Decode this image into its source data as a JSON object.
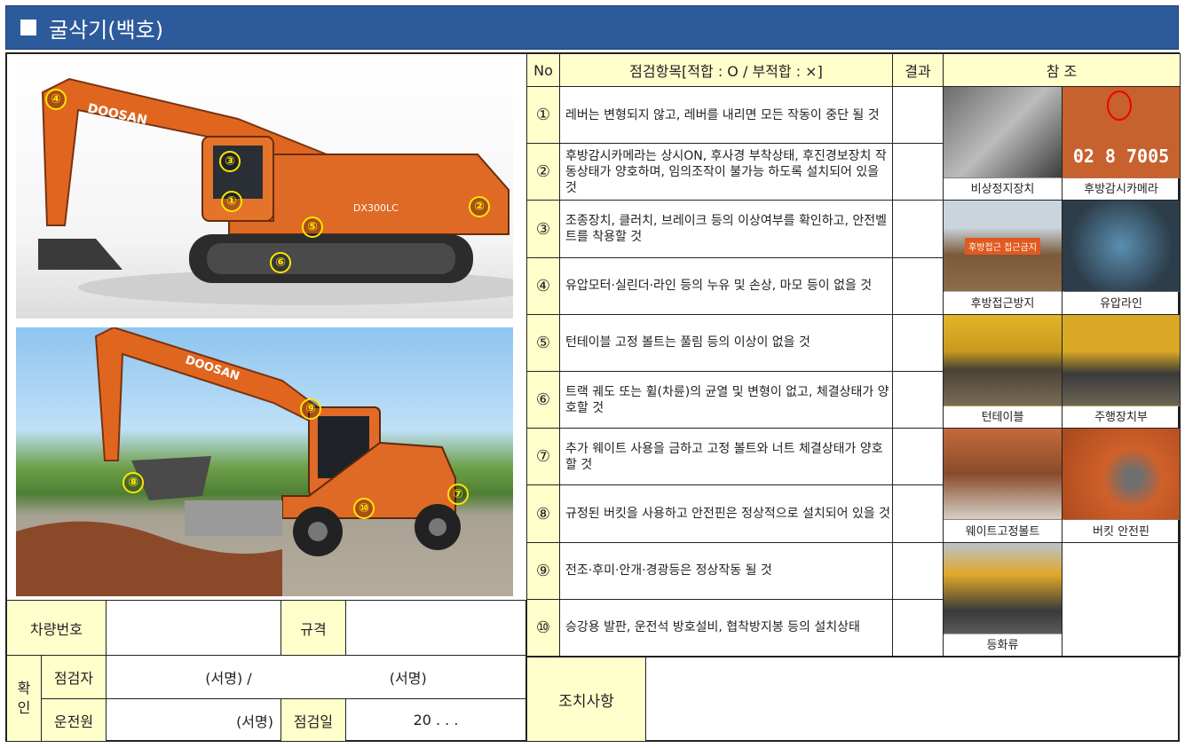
{
  "header": {
    "title": "굴삭기(백호)",
    "color": "#2d5a9b"
  },
  "photos": {
    "top": {
      "brand": "DOOSAN",
      "model": "DX300LC",
      "markers": [
        "④",
        "③",
        "①",
        "②",
        "⑤",
        "⑥"
      ]
    },
    "bottom": {
      "brand": "DOOSAN",
      "markers": [
        "⑨",
        "⑧",
        "⑦",
        "⑩"
      ]
    }
  },
  "info": {
    "vehicle_no_label": "차량번호",
    "spec_label": "규격",
    "confirm_label": "확\n인",
    "inspector_label": "점검자",
    "inspector_sign": "(서명)  /",
    "inspector_sign2": "(서명)",
    "driver_label": "운전원",
    "driver_sign": "(서명)",
    "date_label": "점검일",
    "date_value": "20   .    .    ."
  },
  "checklist": {
    "headers": {
      "no": "No",
      "item": "점검항목[적합 : O / 부적합 : ×]",
      "result": "결과",
      "ref": "참  조"
    },
    "rows": [
      {
        "no": "①",
        "text": "레버는 변형되지 않고, 레버를 내리면 모든 작동이 중단 될 것"
      },
      {
        "no": "②",
        "text": "후방감시카메라는 상시ON, 후사경 부착상태, 후진경보장치 작동상태가 양호하며, 임의조작이 불가능 하도록 설치되어 있을 것"
      },
      {
        "no": "③",
        "text": "조종장치, 클러치, 브레이크 등의 이상여부를 확인하고, 안전벨트를 착용할 것"
      },
      {
        "no": "④",
        "text": "유압모터·실린더·라인 등의 누유 및 손상, 마모 등이 없을 것"
      },
      {
        "no": "⑤",
        "text": "턴테이블 고정 볼트는 풀림 등의 이상이 없을 것"
      },
      {
        "no": "⑥",
        "text": "트랙 궤도 또는 휠(차륜)의 균열 및 변형이 없고, 체결상태가 양호할 것"
      },
      {
        "no": "⑦",
        "text": "추가 웨이트 사용을 금하고 고정 볼트와 너트 체결상태가 양호할 것"
      },
      {
        "no": "⑧",
        "text": "규정된 버킷을 사용하고 안전핀은 정상적으로 설치되어 있을 것"
      },
      {
        "no": "⑨",
        "text": "전조·후미·안개·경광등은 정상작동 될 것"
      },
      {
        "no": "⑩",
        "text": "승강용 발판, 운전석 방호설비, 협착방지봉 등의 설치상태"
      }
    ],
    "refs": [
      {
        "cap1": "비상정지장치",
        "cap2": "후방감시카메라",
        "plate": "02 8 7005"
      },
      {
        "cap1": "후방접근방지",
        "cap2": "유압라인",
        "sign": "후방접근 접근금지"
      },
      {
        "cap1": "턴테이블",
        "cap2": "주행장치부"
      },
      {
        "cap1": "웨이트고정볼트",
        "cap2": "버킷 안전핀"
      },
      {
        "cap1": "등화류",
        "cap2": ""
      }
    ]
  },
  "action": {
    "label": "조치사항"
  }
}
